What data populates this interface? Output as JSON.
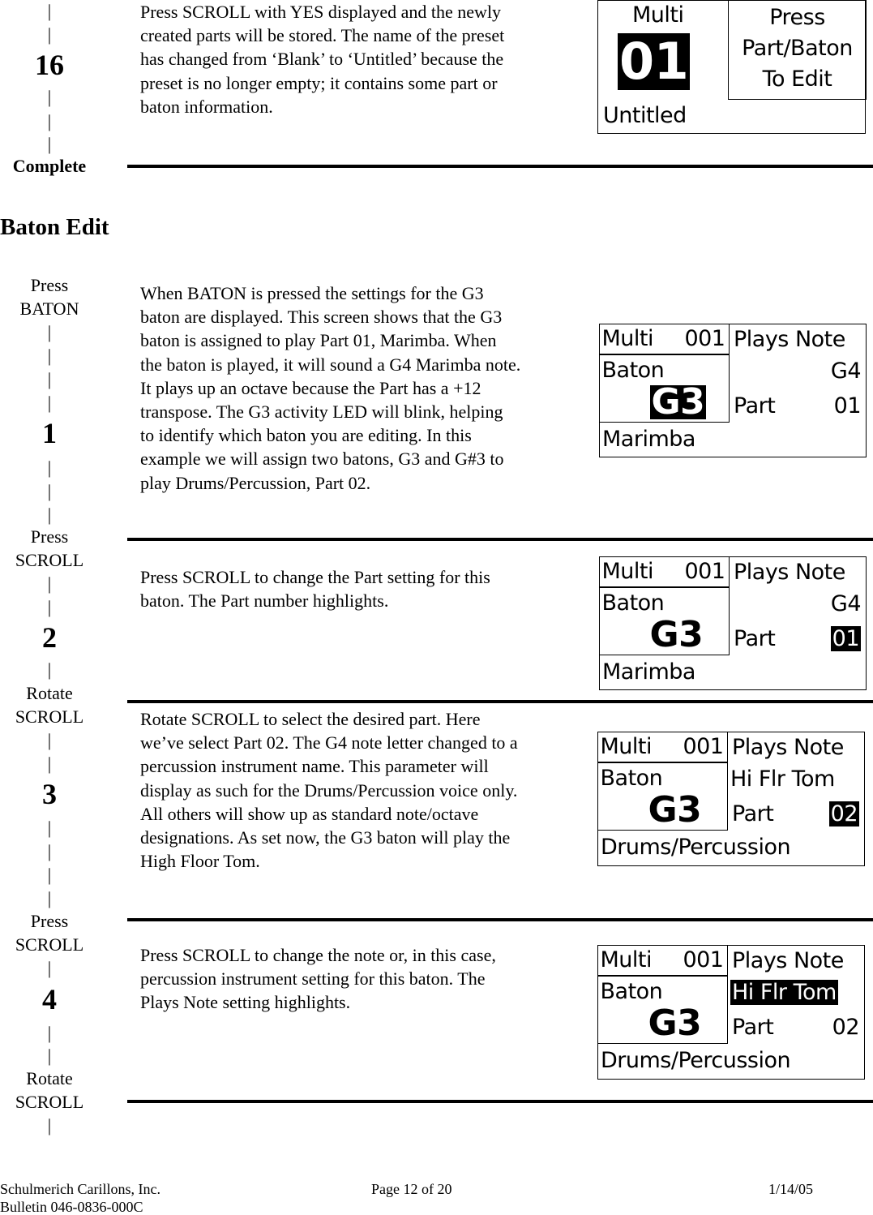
{
  "left_column": {
    "step16": {
      "pipes_top": [
        "|",
        "|"
      ],
      "number": "16",
      "pipes_bottom": [
        "|",
        "|",
        "|"
      ],
      "label": "Complete"
    },
    "baton": [
      "Press",
      "BATON",
      "|",
      "|",
      "|",
      "|",
      "1",
      "|",
      "|",
      "|",
      "Press",
      "SCROLL",
      "|",
      "|",
      "2",
      "|",
      "Rotate",
      "SCROLL",
      "|",
      "|",
      "3",
      "|",
      "|",
      "|",
      "|",
      "Press",
      "SCROLL",
      "|",
      "4",
      "|",
      "|",
      "Rotate",
      "SCROLL",
      "|"
    ]
  },
  "section_title": "Baton Edit",
  "paragraphs": [
    "Press SCROLL with YES displayed and the newly created parts will be stored.  The name of the preset has changed from ‘Blank’ to ‘Untitled’ because the preset is no longer empty; it contains some part or baton information.",
    "When BATON is pressed the settings for the G3 baton are displayed.  This screen shows that the G3 baton is assigned to play Part 01, Marimba.  When the baton is played, it will sound a G4 Marimba note.  It plays up an octave because the Part has a +12 transpose.  The G3 activity LED will blink, helping to identify which baton you are editing.  In this example we will assign two batons, G3 and G#3 to play Drums/Percussion, Part 02.",
    "Press SCROLL to change the Part setting for this baton.  The Part number highlights.",
    "Rotate SCROLL to select the desired part.  Here we’ve select Part 02.  The G4 note letter changed to a percussion instrument name.  This parameter will display as such for the Drums/Percussion voice only.  All others will show up as standard note/octave designations.  As set now, the G3 baton will play the High Floor Tom.",
    "Press SCROLL to change the note or, in this case, percussion instrument setting for this baton.  The Plays Note setting highlights."
  ],
  "screen_complete": {
    "mode": "Multi",
    "preset": "01",
    "name": "Untitled",
    "prompt": [
      "Press",
      "Part/Baton",
      "To Edit"
    ]
  },
  "baton_screens": [
    {
      "mode": "Multi",
      "preset": "001",
      "baton_label": "Baton",
      "baton": "G3",
      "plays_label": "Plays Note",
      "note": "G4",
      "part_label": "Part",
      "part": "01",
      "voice": "Marimba",
      "highlight": "baton"
    },
    {
      "mode": "Multi",
      "preset": "001",
      "baton_label": "Baton",
      "baton": "G3",
      "plays_label": "Plays Note",
      "note": "G4",
      "part_label": "Part",
      "part": "01",
      "voice": "Marimba",
      "highlight": "part"
    },
    {
      "mode": "Multi",
      "preset": "001",
      "baton_label": "Baton",
      "baton": "G3",
      "plays_label": "Plays Note",
      "note": "Hi Flr Tom",
      "part_label": "Part",
      "part": "02",
      "voice": "Drums/Percussion",
      "highlight": "part"
    },
    {
      "mode": "Multi",
      "preset": "001",
      "baton_label": "Baton",
      "baton": "G3",
      "plays_label": "Plays Note",
      "note": "Hi Flr Tom",
      "part_label": "Part",
      "part": "02",
      "voice": "Drums/Percussion",
      "highlight": "note"
    }
  ],
  "footer": {
    "company": "Schulmerich Carillons, Inc.",
    "page": "Page 12 of 20",
    "date": "1/14/05",
    "bulletin": "Bulletin 046-0836-000C"
  }
}
